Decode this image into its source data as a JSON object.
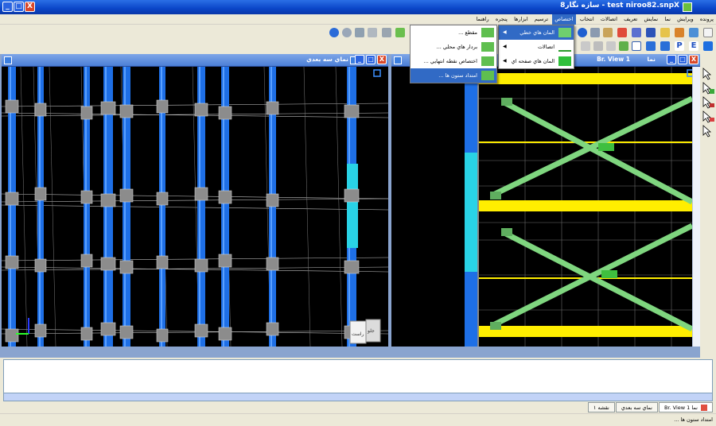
{
  "window": {
    "title": "test niroo82.snpX - سازه نگار8",
    "minimize": "_",
    "maximize": "□",
    "close": "X"
  },
  "menubar": [
    {
      "label": "پرونده"
    },
    {
      "label": "ويرايش"
    },
    {
      "label": "نما"
    },
    {
      "label": "نمايش"
    },
    {
      "label": "تعريف"
    },
    {
      "label": "اتصالات"
    },
    {
      "label": "انتخاب"
    },
    {
      "label": "اختصاص"
    },
    {
      "label": "ترسيم"
    },
    {
      "label": "ابزارها"
    },
    {
      "label": "پنجره"
    },
    {
      "label": "راهنما"
    }
  ],
  "assign_menu": {
    "items": [
      {
        "label": "المان هاي خطي",
        "icon": "line-element-icon",
        "has_submenu": true
      },
      {
        "label": "اتصالات",
        "icon": "joint-icon",
        "has_submenu": true
      },
      {
        "label": "المان هاي صفحه اي",
        "icon": "shell-element-icon",
        "has_submenu": true
      }
    ]
  },
  "line_submenu": {
    "items": [
      {
        "label": "مقطع ..."
      },
      {
        "label": "بردار هاي محلي ..."
      },
      {
        "label": "اختصاص نقطه انتهايي ..."
      },
      {
        "label": "امتداد ستون ها ..."
      }
    ]
  },
  "left_view": {
    "title": "نماي سه بعدي",
    "cube_labels": {
      "front": "راست",
      "side": "جلو"
    }
  },
  "right_view": {
    "title": "Br. View 1",
    "title_suffix": "نما"
  },
  "doc_tabs": [
    {
      "label": "نما Br. View 1",
      "selected": true
    },
    {
      "label": "نماي سه بعدي",
      "selected": false
    },
    {
      "label": "نقشه ۱",
      "selected": false
    }
  ],
  "status": {
    "text": "امتداد ستون ها ..."
  },
  "colors": {
    "column_blue": "#1e6fe6",
    "column_highlight": "#29d3e6",
    "beam_yellow": "#ffee00",
    "brace_green": "#7fd67f",
    "menu_highlight": "#316ac5"
  }
}
